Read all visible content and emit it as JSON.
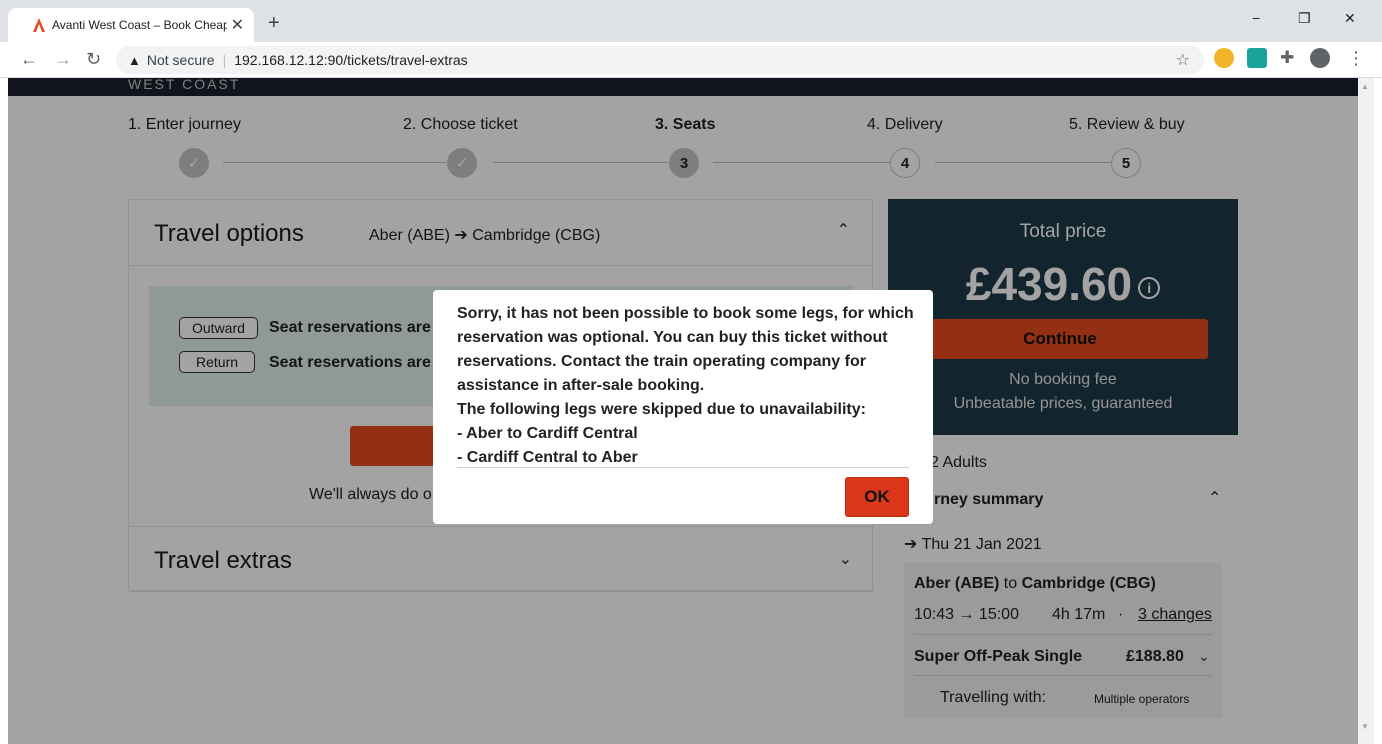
{
  "browser": {
    "tab_title": "Avanti West Coast – Book Cheap",
    "tab_close": "✕",
    "new_tab": "+",
    "not_secure": "Not secure",
    "url": "192.168.12.12:90/tickets/travel-extras",
    "minimize": "−",
    "restore": "❐",
    "close": "✕"
  },
  "header": {
    "logo_text": "WEST COAST"
  },
  "steps": [
    {
      "label": "1. Enter journey",
      "state": "done",
      "marker": "✓"
    },
    {
      "label": "2. Choose ticket",
      "state": "done",
      "marker": "✓"
    },
    {
      "label": "3. Seats",
      "state": "current",
      "marker": "3"
    },
    {
      "label": "4. Delivery",
      "state": "todo",
      "marker": "4"
    },
    {
      "label": "5. Review & buy",
      "state": "todo",
      "marker": "5"
    }
  ],
  "travel_options": {
    "heading": "Travel options",
    "route_from": "Aber (ABE)",
    "arrow": "➔",
    "route_to": "Cambridge (CBG)",
    "outward_pill": "Outward",
    "return_pill": "Return",
    "seat_text": "Seat reservations are",
    "always_text": "We'll always do o"
  },
  "travel_extras": {
    "heading": "Travel extras"
  },
  "summary": {
    "total_label": "Total price",
    "total_amount": "£439.60",
    "info_icon": "i",
    "continue_label": "Continue",
    "no_fee": "No booking fee",
    "guarantee": "Unbeatable prices, guaranteed",
    "adults": "2 Adults",
    "journey_summary": "rney summary",
    "date_arrow": "➔",
    "date": "Thu 21 Jan 2021",
    "route_from": "Aber (ABE)",
    "route_to_word": "to",
    "route_to": "Cambridge (CBG)",
    "times": "10:43 → 15:00",
    "duration": "4h 17m",
    "dot": "·",
    "changes": "3 changes",
    "ticket_name": "Super Off-Peak Single",
    "ticket_price": "£188.80",
    "travelling_with": "Travelling with:",
    "operators": "Multiple operators"
  },
  "dialog": {
    "lines": [
      "Sorry, it has not been possible to book some legs, for which",
      "reservation was optional. You can buy this ticket without",
      "reservations. Contact the train operating company for",
      "assistance in after-sale booking.",
      "The following legs were skipped due to unavailability:",
      "- Aber to Cardiff Central",
      "- Cardiff Central to Aber"
    ],
    "ok_label": "OK"
  },
  "colors": {
    "accent": "#e64b1e",
    "ok_button": "#d9361a",
    "price_panel": "#1d3a48",
    "seat_box": "#e2f1ea"
  }
}
